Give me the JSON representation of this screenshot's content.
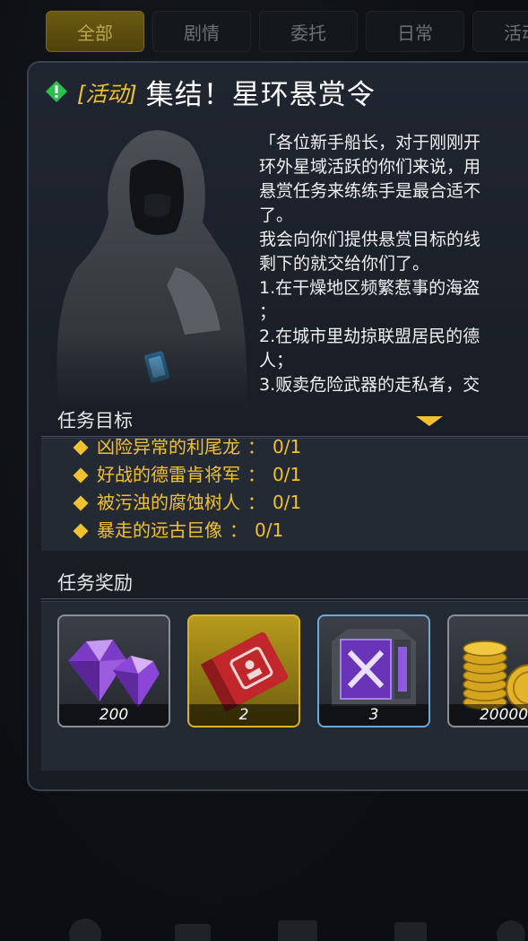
{
  "tabs": [
    {
      "label": "全部",
      "active": true
    },
    {
      "label": "剧情",
      "active": false
    },
    {
      "label": "委托",
      "active": false
    },
    {
      "label": "日常",
      "active": false
    },
    {
      "label": "活动",
      "active": false
    }
  ],
  "quest": {
    "tag": "[活动]",
    "title": "集结！星环悬赏令",
    "story_lines": [
      "「各位新手船长，对于刚刚开",
      "环外星域活跃的你们来说，用",
      "悬赏任务来练练手是最合适不",
      "了。",
      "我会向你们提供悬赏目标的线",
      "剩下的就交给你们了。",
      "1.在干燥地区频繁惹事的海盗",
      "；",
      "2.在城市里劫掠联盟居民的德",
      "人；",
      "3.贩卖危险武器的走私者，交"
    ]
  },
  "objectives_header": "任务目标",
  "objectives": [
    {
      "name": "凶险异常的利尾龙",
      "progress": "0/1"
    },
    {
      "name": "好战的德雷肯将军",
      "progress": "0/1"
    },
    {
      "name": "被污浊的腐蚀树人",
      "progress": "0/1"
    },
    {
      "name": "暴走的远古巨像",
      "progress": "0/1"
    }
  ],
  "rewards_header": "任务奖励",
  "rewards": [
    {
      "icon": "purple-crystal-icon",
      "qty": "200",
      "frame": "gray"
    },
    {
      "icon": "red-ticket-icon",
      "qty": "2",
      "frame": "gold"
    },
    {
      "icon": "purple-supply-crate-icon",
      "qty": "3",
      "frame": "blue"
    },
    {
      "icon": "gold-coins-icon",
      "qty": "20000",
      "frame": "gray"
    }
  ],
  "colors": {
    "accent": "#f2c12e",
    "alert_green": "#2bbf4f",
    "panel_border": "#3a4250"
  }
}
